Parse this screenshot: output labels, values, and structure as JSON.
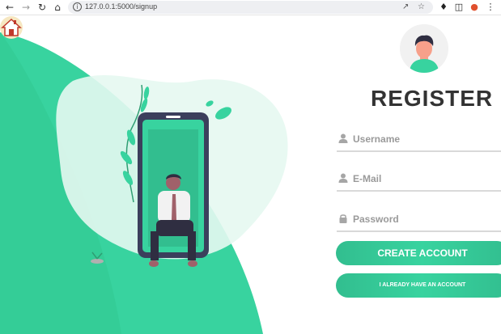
{
  "browser": {
    "url": "127.0.0.1:5000/signup",
    "icons": [
      "back-icon",
      "forward-icon",
      "reload-icon",
      "home-icon",
      "site-info-icon",
      "share-icon",
      "bookmark-star-icon",
      "extensions-puzzle-icon",
      "side-panel-icon",
      "profile-extension-icon",
      "menu-dots-icon"
    ]
  },
  "page": {
    "home_link_icon": "house-icon",
    "avatar_icon": "user-avatar-icon",
    "title": "REGISTER",
    "fields": {
      "username": {
        "placeholder": "Username",
        "icon": "user-icon"
      },
      "email": {
        "placeholder": "E-Mail",
        "icon": "user-icon"
      },
      "password": {
        "placeholder": "Password",
        "icon": "lock-icon"
      }
    },
    "buttons": {
      "create": "CREATE ACCOUNT",
      "login": "I ALREADY HAVE AN ACCOUNT"
    },
    "colors": {
      "accent": "#38d39f",
      "accent_dark": "#32be8f",
      "title": "#333333"
    }
  }
}
